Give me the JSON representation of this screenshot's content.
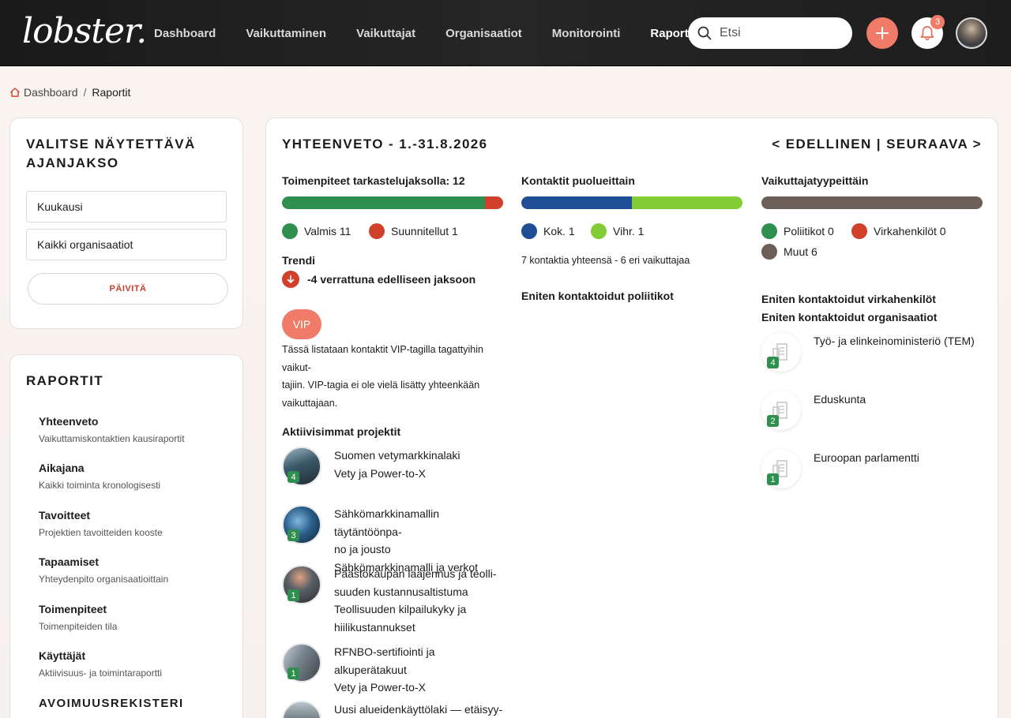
{
  "header": {
    "logo": "lobster.",
    "nav": [
      "Dashboard",
      "Vaikuttaminen",
      "Vaikuttajat",
      "Organisaatiot",
      "Monitorointi",
      "Raportit"
    ],
    "active_nav": "Raportit",
    "search_placeholder": "Etsi",
    "notification_count": "3"
  },
  "breadcrumb": {
    "home": "Dashboard",
    "separator": "/",
    "current": "Raportit"
  },
  "period": {
    "title": "VALITSE NÄYTETTÄVÄ AJANJAKSO",
    "period_select": "Kuukausi",
    "org_select": "Kaikki organisaatiot",
    "update_label": "PÄIVITÄ"
  },
  "reports": {
    "title": "RAPORTIT",
    "items": [
      {
        "title": "Yhteenveto",
        "subtitle": "Vaikuttamiskontaktien kausiraportit"
      },
      {
        "title": "Aikajana",
        "subtitle": "Kaikki toiminta kronologisesti"
      },
      {
        "title": "Tavoitteet",
        "subtitle": "Projektien tavoitteiden kooste"
      },
      {
        "title": "Tapaamiset",
        "subtitle": "Yhteydenpito organisaatioittain"
      },
      {
        "title": "Toimenpiteet",
        "subtitle": "Toimenpiteiden tila"
      },
      {
        "title": "Käyttäjät",
        "subtitle": "Aktiivisuus- ja toimintaraportti"
      }
    ],
    "section2_title": "AVOIMUUSREKISTERI"
  },
  "summary": {
    "title": "YHTEENVETO - 1.-31.8.2026",
    "prev_next": "< EDELLINEN | SEURAAVA >",
    "actions": {
      "title": "Toimenpiteet tarkastelujaksolla: 12",
      "done_label": "Valmis 11",
      "done": 11,
      "planned_label": "Suunnitellut 1",
      "planned": 1,
      "done_color": "#2f8f4f",
      "planned_color": "#d0402b"
    },
    "trend": {
      "title": "Trendi",
      "text": "-4 verrattuna edelliseen jaksoon"
    },
    "vip": {
      "label": "VIP",
      "text1": "Tässä listataan kontaktit VIP-tagilla tagattyihin vaikut-",
      "text2": "tajiin. VIP-tagia ei ole vielä lisätty yhteenkään",
      "text3": "vaikuttajaan."
    },
    "projects_title": "Aktiivisimmat projektit",
    "projects": [
      {
        "count": "4",
        "lines": [
          "Suomen vetymarkkinalaki",
          "Vety ja Power-to-X"
        ]
      },
      {
        "count": "3",
        "lines": [
          "Sähkömarkkinamallin täytäntöönpa-",
          "no ja jousto",
          "Sähkömarkkinamalli ja verkot"
        ]
      },
      {
        "count": "1",
        "lines": [
          "Päästökaupan laajennus ja teolli-",
          "suuden kustannusaltistuma",
          "Teollisuuden kilpailukyky ja",
          "hiilikustannukset"
        ]
      },
      {
        "count": "1",
        "lines": [
          "RFNBO-sertifiointi ja alkuperätakuut",
          "Vety ja Power-to-X"
        ]
      },
      {
        "count": "",
        "lines": [
          "Uusi alueidenkäyttölaki — etäisyy-"
        ]
      }
    ],
    "parties": {
      "title": "Kontaktit puolueittain",
      "kok_label": "Kok. 1",
      "kok": 1,
      "kok_color": "#1f4e94",
      "vihr_label": "Vihr. 1",
      "vihr": 1,
      "vihr_color": "#82cc36",
      "total_text": "7 kontaktia yhteensä - 6 eri vaikuttajaa",
      "top_politicians_title": "Eniten kontaktoidut poliitikot"
    },
    "types": {
      "title": "Vaikuttajatyypeittäin",
      "politicians_label": "Poliitikot 0",
      "officials_label": "Virkahenkilöt 0",
      "others_label": "Muut 6",
      "others": 6,
      "politicians_color": "#2f8f4f",
      "officials_color": "#d0402b",
      "others_color": "#6b5f58",
      "top_officials_title": "Eniten kontaktoidut virkahenkilöt",
      "top_orgs_title": "Eniten kontaktoidut organisaatiot",
      "orgs": [
        {
          "name": "Työ- ja elinkeinoministeriö (TEM)",
          "count": "4"
        },
        {
          "name": "Eduskunta",
          "count": "2"
        },
        {
          "name": "Euroopan parlamentti",
          "count": "1"
        }
      ]
    }
  }
}
